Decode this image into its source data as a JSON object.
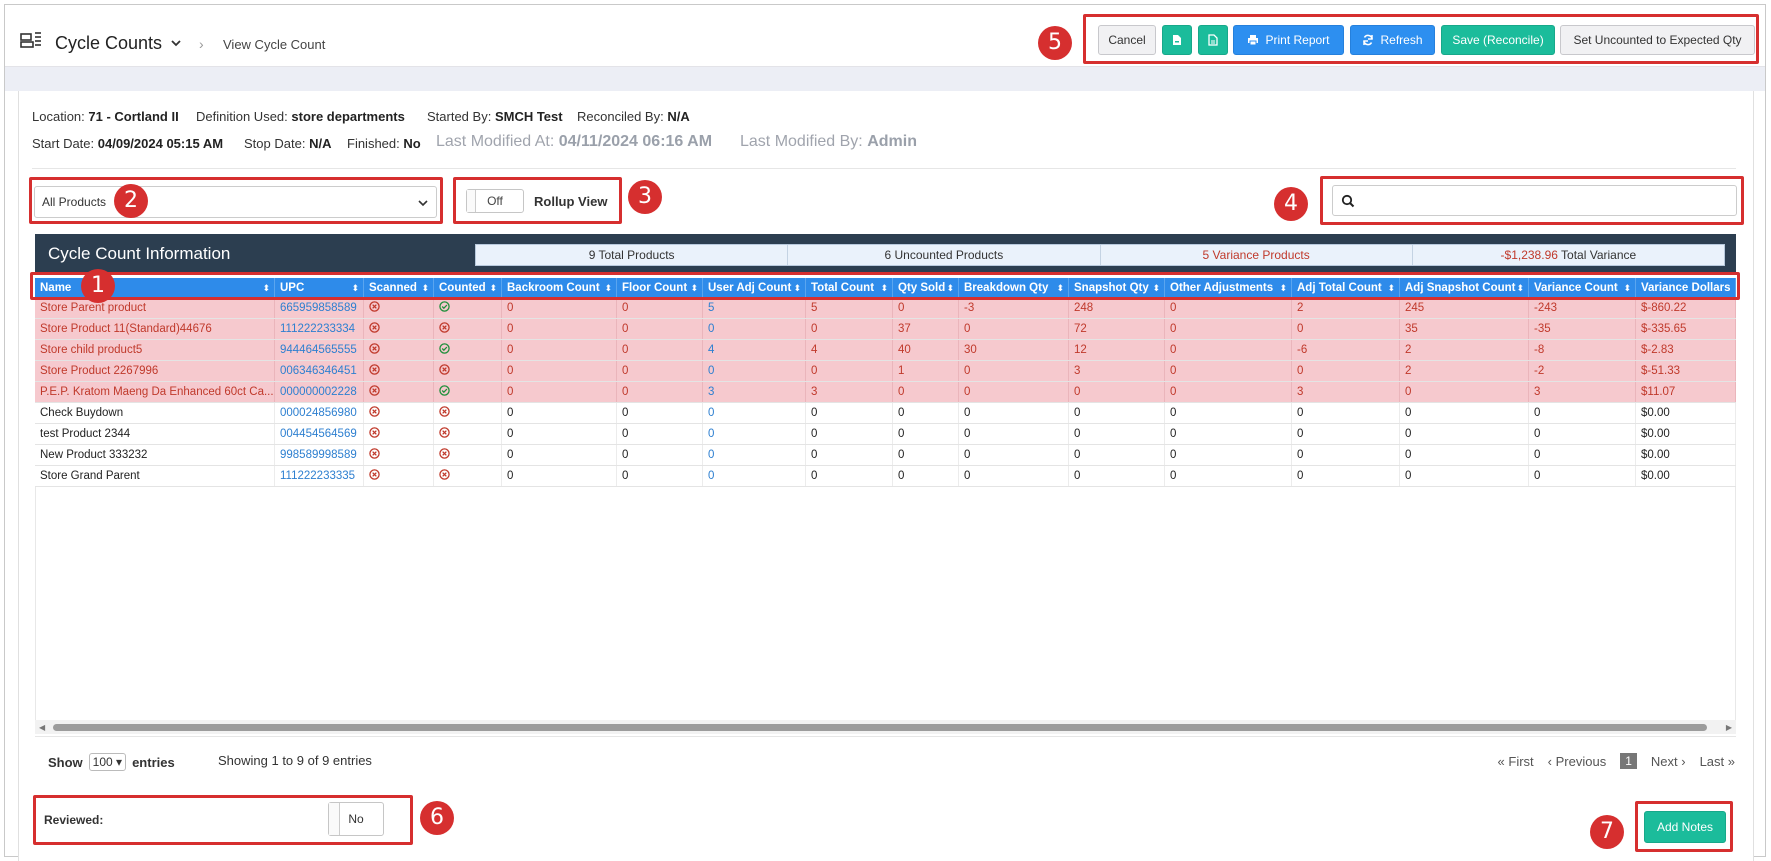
{
  "header": {
    "app_title": "Cycle Counts",
    "breadcrumb": "View Cycle Count",
    "buttons": {
      "cancel": "Cancel",
      "print_report": "Print Report",
      "refresh": "Refresh",
      "save_reconcile": "Save (Reconcile)",
      "set_uncounted": "Set Uncounted to Expected Qty"
    }
  },
  "meta": {
    "location_label": "Location:",
    "location": "71 - Cortland II",
    "definition_label": "Definition Used:",
    "definition": "store departments",
    "started_by_label": "Started By:",
    "started_by": "SMCH Test",
    "reconciled_by_label": "Reconciled By:",
    "reconciled_by": "N/A",
    "start_date_label": "Start Date:",
    "start_date": "04/09/2024 05:15 AM",
    "stop_date_label": "Stop Date:",
    "stop_date": "N/A",
    "finished_label": "Finished:",
    "finished": "No",
    "last_modified_at_label": "Last Modified At:",
    "last_modified_at": "04/11/2024 06:16 AM",
    "last_modified_by_label": "Last Modified By:",
    "last_modified_by": "Admin"
  },
  "filters": {
    "product_filter": "All Products",
    "rollup_toggle": "Off",
    "rollup_label": "Rollup View",
    "search_value": ""
  },
  "panel": {
    "title": "Cycle Count Information",
    "total_products": "9 Total Products",
    "uncounted_products": "6 Uncounted Products",
    "variance_products": "5 Variance Products",
    "total_variance_value": "-$1,238.96",
    "total_variance_label": "Total Variance"
  },
  "columns": [
    "Name",
    "UPC",
    "Scanned",
    "Counted",
    "Backroom Count",
    "Floor Count",
    "User Adj Count",
    "Total Count",
    "Qty Sold",
    "Breakdown Qty",
    "Snapshot Qty",
    "Other Adjustments",
    "Adj Total Count",
    "Adj Snapshot Count",
    "Variance Count",
    "Variance Dollars"
  ],
  "rows": [
    {
      "variance": true,
      "name": "Store Parent product",
      "upc": "665959858589",
      "scanned": "x",
      "counted": "check",
      "backroom": "0",
      "floor": "0",
      "user_adj": "5",
      "total": "5",
      "qty_sold": "0",
      "breakdown": "-3",
      "snapshot": "248",
      "other_adj": "0",
      "adj_total": "2",
      "adj_snapshot": "245",
      "var_count": "-243",
      "var_dollars": "$-860.22"
    },
    {
      "variance": true,
      "name": "Store Product 11(Standard)44676",
      "upc": "111222233334",
      "scanned": "x",
      "counted": "x",
      "backroom": "0",
      "floor": "0",
      "user_adj": "0",
      "total": "0",
      "qty_sold": "37",
      "breakdown": "0",
      "snapshot": "72",
      "other_adj": "0",
      "adj_total": "0",
      "adj_snapshot": "35",
      "var_count": "-35",
      "var_dollars": "$-335.65"
    },
    {
      "variance": true,
      "name": "Store child product5",
      "upc": "944464565555",
      "scanned": "x",
      "counted": "check",
      "backroom": "0",
      "floor": "0",
      "user_adj": "4",
      "total": "4",
      "qty_sold": "40",
      "breakdown": "30",
      "snapshot": "12",
      "other_adj": "0",
      "adj_total": "-6",
      "adj_snapshot": "2",
      "var_count": "-8",
      "var_dollars": "$-2.83"
    },
    {
      "variance": true,
      "name": "Store Product 2267996",
      "upc": "006346346451",
      "scanned": "x",
      "counted": "x",
      "backroom": "0",
      "floor": "0",
      "user_adj": "0",
      "total": "0",
      "qty_sold": "1",
      "breakdown": "0",
      "snapshot": "3",
      "other_adj": "0",
      "adj_total": "0",
      "adj_snapshot": "2",
      "var_count": "-2",
      "var_dollars": "$-51.33"
    },
    {
      "variance": true,
      "name": "P.E.P. Kratom Maeng Da Enhanced 60ct Ca...",
      "upc": "000000002228",
      "scanned": "x",
      "counted": "check",
      "backroom": "0",
      "floor": "0",
      "user_adj": "3",
      "total": "3",
      "qty_sold": "0",
      "breakdown": "0",
      "snapshot": "0",
      "other_adj": "0",
      "adj_total": "3",
      "adj_snapshot": "0",
      "var_count": "3",
      "var_dollars": "$11.07"
    },
    {
      "variance": false,
      "name": "Check Buydown",
      "upc": "000024856980",
      "scanned": "x",
      "counted": "x",
      "backroom": "0",
      "floor": "0",
      "user_adj": "0",
      "total": "0",
      "qty_sold": "0",
      "breakdown": "0",
      "snapshot": "0",
      "other_adj": "0",
      "adj_total": "0",
      "adj_snapshot": "0",
      "var_count": "0",
      "var_dollars": "$0.00"
    },
    {
      "variance": false,
      "name": "test Product 2344",
      "upc": "004454564569",
      "scanned": "x",
      "counted": "x",
      "backroom": "0",
      "floor": "0",
      "user_adj": "0",
      "total": "0",
      "qty_sold": "0",
      "breakdown": "0",
      "snapshot": "0",
      "other_adj": "0",
      "adj_total": "0",
      "adj_snapshot": "0",
      "var_count": "0",
      "var_dollars": "$0.00"
    },
    {
      "variance": false,
      "name": "New Product 333232",
      "upc": "998589998589",
      "scanned": "x",
      "counted": "x",
      "backroom": "0",
      "floor": "0",
      "user_adj": "0",
      "total": "0",
      "qty_sold": "0",
      "breakdown": "0",
      "snapshot": "0",
      "other_adj": "0",
      "adj_total": "0",
      "adj_snapshot": "0",
      "var_count": "0",
      "var_dollars": "$0.00"
    },
    {
      "variance": false,
      "name": "Store Grand Parent",
      "upc": "111222233335",
      "scanned": "x",
      "counted": "x",
      "backroom": "0",
      "floor": "0",
      "user_adj": "0",
      "total": "0",
      "qty_sold": "0",
      "breakdown": "0",
      "snapshot": "0",
      "other_adj": "0",
      "adj_total": "0",
      "adj_snapshot": "0",
      "var_count": "0",
      "var_dollars": "$0.00"
    }
  ],
  "footer": {
    "show_label": "Show",
    "entries_value": "100",
    "entries_label": "entries",
    "showing_text": "Showing 1 to 9 of 9 entries",
    "first": "First",
    "previous": "Previous",
    "page": "1",
    "next": "Next",
    "last": "Last",
    "reviewed_label": "Reviewed:",
    "reviewed_toggle": "No",
    "add_notes": "Add Notes"
  },
  "annotations": [
    "1",
    "2",
    "3",
    "4",
    "5",
    "6",
    "7"
  ],
  "colors": {
    "header_row": "#2e8bea",
    "panel_bar": "#2c3e50",
    "variance_row": "#f6c9ce",
    "teal": "#1bbc9b",
    "blue": "#2d8ff0",
    "annotation_red": "#d62f2f"
  },
  "icons": {
    "app": "register-icon",
    "scanned_false": "x-circle-icon",
    "counted_true": "check-circle-icon",
    "search": "search-icon",
    "print": "printer-icon",
    "refresh": "refresh-icon",
    "file": "file-icon"
  }
}
